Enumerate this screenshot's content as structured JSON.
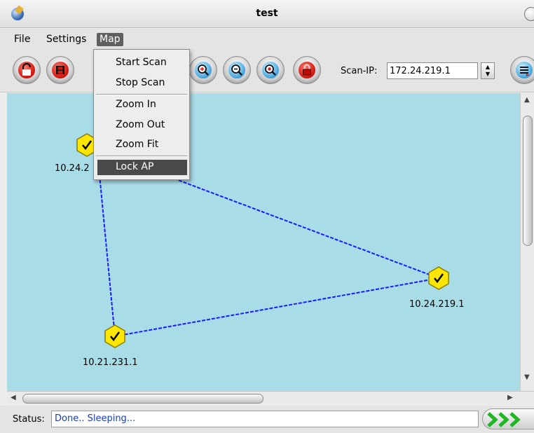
{
  "window": {
    "title": "test"
  },
  "menubar": {
    "items": [
      "File",
      "Settings",
      "Map"
    ],
    "active": "Map"
  },
  "map_menu": {
    "items": [
      "Start Scan",
      "Stop Scan",
      "Zoom In",
      "Zoom Out",
      "Zoom Fit",
      "Lock AP"
    ],
    "highlighted": "Lock AP"
  },
  "toolbar": {
    "buttons": [
      "open-icon",
      "save-icon",
      "zoom-in-icon",
      "zoom-out-icon",
      "zoom-fit-icon",
      "lock-icon",
      "menu-icon"
    ],
    "scan_ip_label": "Scan-IP:",
    "scan_ip_value": "172.24.219.1"
  },
  "map": {
    "background": "#a8dce7",
    "link_color": "#1a1aff",
    "nodes": [
      {
        "label": "10.24.2",
        "status": "ok"
      },
      {
        "label": "10.24.219.1",
        "status": "ok"
      },
      {
        "label": "10.21.231.1",
        "status": "ok"
      }
    ]
  },
  "status": {
    "label": "Status:",
    "text": "Done.. Sleeping..."
  }
}
